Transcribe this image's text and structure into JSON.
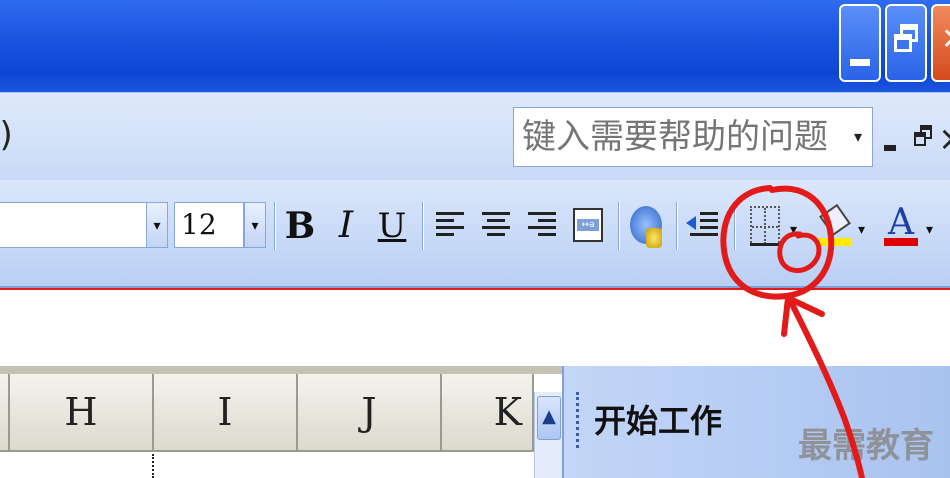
{
  "menubar": {
    "menu_edge_text": "j)",
    "help_placeholder": "键入需要帮助的问题",
    "help_dropdown": "▾"
  },
  "toolbar": {
    "font_size": "12",
    "bold": "B",
    "italic": "I",
    "underline": "U",
    "font_color_glyph": "A",
    "dropdown_glyph": "▾"
  },
  "grid": {
    "columns": [
      "H",
      "I",
      "J",
      "K"
    ],
    "scroll_up_glyph": "▲"
  },
  "taskpane": {
    "title": "开始工作",
    "more": "▾"
  },
  "watermark": "最需教育",
  "colors": {
    "titlebar": "#1a55e0",
    "annotation": "#e31a1a",
    "font_color": "#e00000",
    "fill_color": "#ffea00"
  }
}
